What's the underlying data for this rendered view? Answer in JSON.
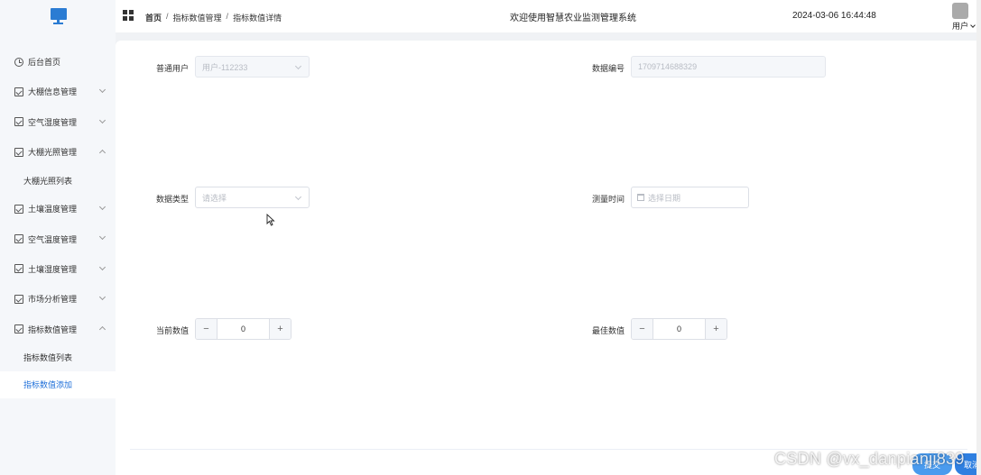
{
  "header": {
    "breadcrumb": [
      "首页",
      "指标数值管理",
      "指标数值详情"
    ],
    "breadcrumb_sep": "/",
    "app_title": "欢迎使用智慧农业监测管理系统",
    "datetime": "2024-03-06 16:44:48",
    "user_label": "用户"
  },
  "sidebar": {
    "items": [
      {
        "label": "后台首页",
        "icon": "clock-icon"
      },
      {
        "label": "大棚信息管理",
        "icon": "box-icon",
        "expand": "collapsed"
      },
      {
        "label": "空气湿度管理",
        "icon": "box-icon",
        "expand": "collapsed"
      },
      {
        "label": "大棚光照管理",
        "icon": "box-icon",
        "expand": "expanded"
      },
      {
        "label": "大棚光照列表",
        "sub": true
      },
      {
        "label": "土壤温度管理",
        "icon": "box-icon",
        "expand": "collapsed"
      },
      {
        "label": "空气温度管理",
        "icon": "box-icon",
        "expand": "collapsed"
      },
      {
        "label": "土壤湿度管理",
        "icon": "box-icon",
        "expand": "collapsed"
      },
      {
        "label": "市场分析管理",
        "icon": "box-icon",
        "expand": "collapsed"
      },
      {
        "label": "指标数值管理",
        "icon": "box-icon",
        "expand": "expanded"
      },
      {
        "label": "指标数值列表",
        "sub": true
      },
      {
        "label": "指标数值添加",
        "sub": true,
        "active": true
      }
    ]
  },
  "form": {
    "user": {
      "label": "普通用户",
      "value": "用户-112233"
    },
    "data_no": {
      "label": "数据编号",
      "value": "1709714688329"
    },
    "data_type": {
      "label": "数据类型",
      "placeholder": "请选择"
    },
    "measure_time": {
      "label": "测量时间",
      "placeholder": "选择日期"
    },
    "current_value": {
      "label": "当前数值",
      "value": "0",
      "minus": "−",
      "plus": "+"
    },
    "best_value": {
      "label": "最佳数值",
      "value": "0",
      "minus": "−",
      "plus": "+"
    }
  },
  "footer": {
    "submit_label": "提交",
    "cancel_label": "取消",
    "watermark": "CSDN @vx_danpianji839"
  },
  "colors": {
    "accent": "#1e6fd9",
    "logo": "#2b7cd3",
    "submit": "#4a9bee",
    "cancel": "#2f7fe0"
  }
}
